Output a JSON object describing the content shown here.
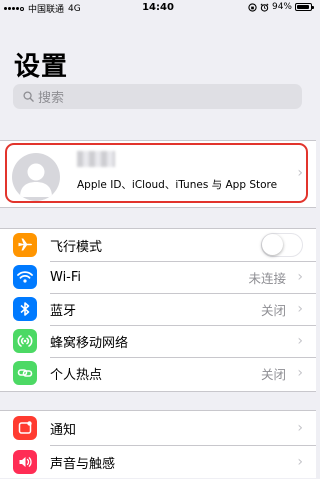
{
  "status_bar": {
    "carrier": "中国联通",
    "network": "4G",
    "time": "14:40",
    "battery_text": "94%",
    "battery_level": 0.94
  },
  "page": {
    "title": "设置"
  },
  "search": {
    "placeholder": "搜索"
  },
  "profile": {
    "subtitle": "Apple ID、iCloud、iTunes 与 App Store"
  },
  "group1": [
    {
      "label": "飞行模式",
      "icon": "airplane-icon",
      "color": "#ff9500",
      "toggle": false
    },
    {
      "label": "Wi-Fi",
      "icon": "wifi-icon",
      "color": "#007aff",
      "value": "未连接"
    },
    {
      "label": "蓝牙",
      "icon": "bluetooth-icon",
      "color": "#007aff",
      "value": "关闭"
    },
    {
      "label": "蜂窝移动网络",
      "icon": "cellular-icon",
      "color": "#4cd964",
      "value": ""
    },
    {
      "label": "个人热点",
      "icon": "hotspot-icon",
      "color": "#4cd964",
      "value": "关闭"
    }
  ],
  "group2": [
    {
      "label": "通知",
      "icon": "notifications-icon",
      "color": "#ff3b30"
    },
    {
      "label": "声音与触感",
      "icon": "sounds-icon",
      "color": "#ff2d55"
    }
  ]
}
